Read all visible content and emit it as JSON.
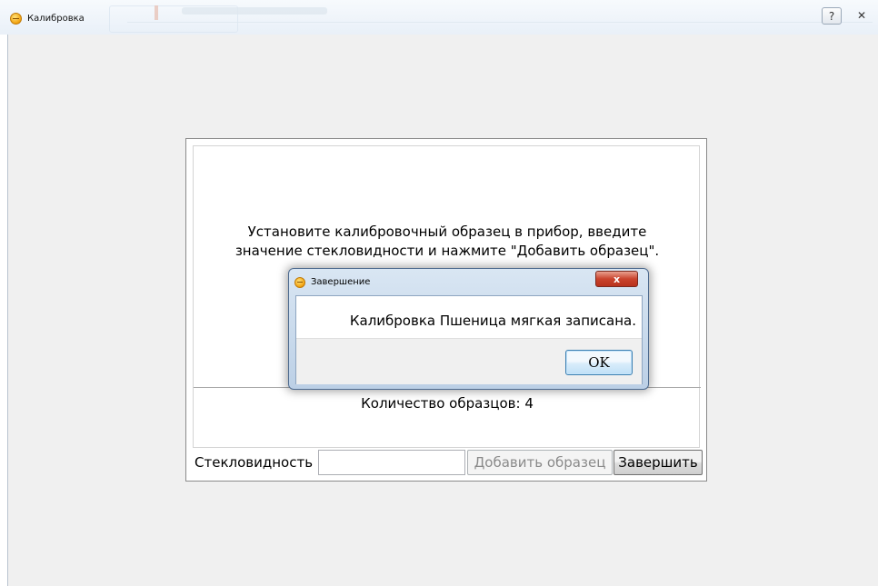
{
  "window": {
    "title": "Калибровка",
    "help_label": "?",
    "close_label": "✕"
  },
  "panel": {
    "instruction_line1": "Установите калибровочный образец в прибор, введите",
    "instruction_line2": "значение стекловидности и нажмите \"Добавить образец\".",
    "count_text": "Количество образцов: 4"
  },
  "form": {
    "glass_label": "Стекловидность",
    "glass_value": "",
    "add_button": "Добавить образец",
    "finish_button": "Завершить"
  },
  "dialog": {
    "title": "Завершение",
    "close_label": "x",
    "message": "Калибровка Пшеница мягкая записана.",
    "ok_button": "OK"
  }
}
